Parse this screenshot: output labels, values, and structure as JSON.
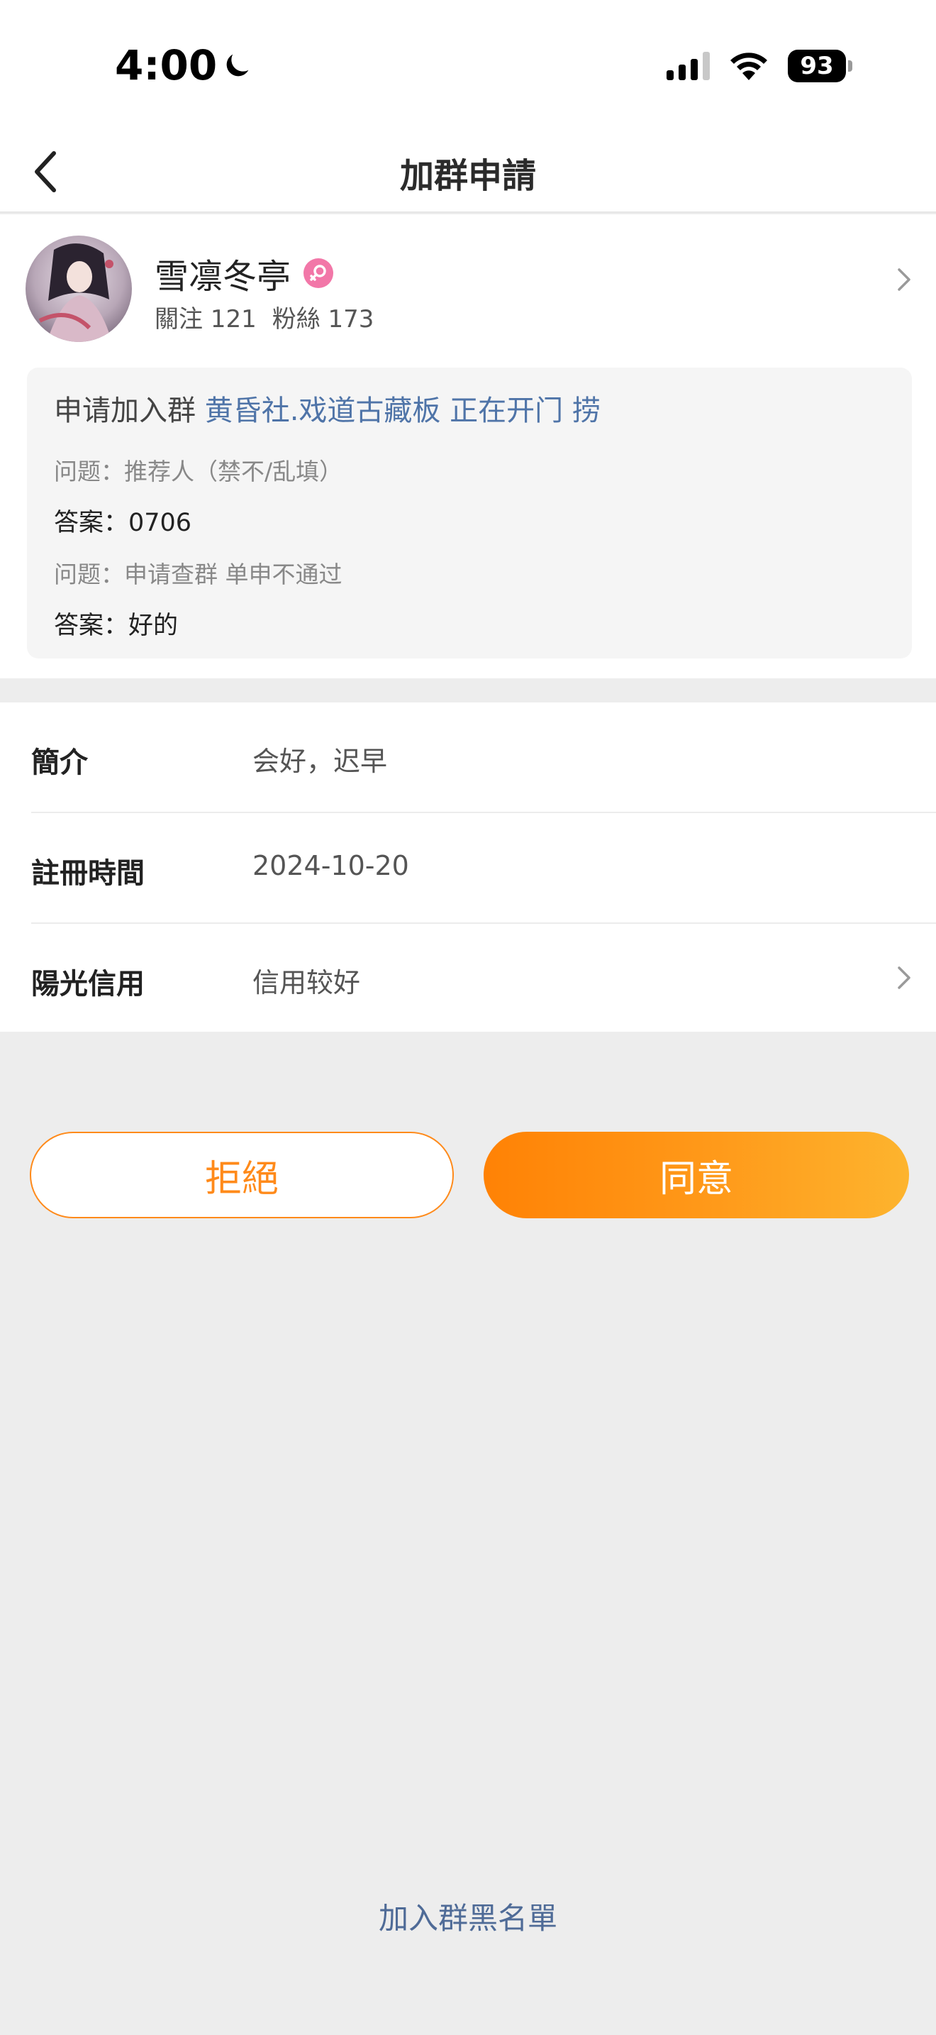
{
  "status_bar": {
    "time": "4:00",
    "battery": "93"
  },
  "nav": {
    "title": "加群申請"
  },
  "profile": {
    "name": "雪凛冬亭",
    "following_label": "關注",
    "following_count": "121",
    "followers_label": "粉絲",
    "followers_count": "173"
  },
  "application": {
    "prefix": "申请加入群",
    "group_name": "黄昏社.戏道古藏板 正在开门 捞",
    "question1": "问题：推荐人（禁不/乱填）",
    "answer1": "答案：0706",
    "question2": "问题：申请查群 单申不通过",
    "answer2": "答案：好的"
  },
  "info": {
    "intro_label": "簡介",
    "intro_value": "会好，迟早",
    "register_label": "註冊時間",
    "register_value": "2024-10-20",
    "credit_label": "陽光信用",
    "credit_value": "信用较好"
  },
  "actions": {
    "reject_label": "拒絕",
    "agree_label": "同意",
    "blacklist_label": "加入群黑名單"
  },
  "colors": {
    "accent": "#ff8a1a",
    "link": "#4f74a8",
    "badge": "#f277a8"
  }
}
